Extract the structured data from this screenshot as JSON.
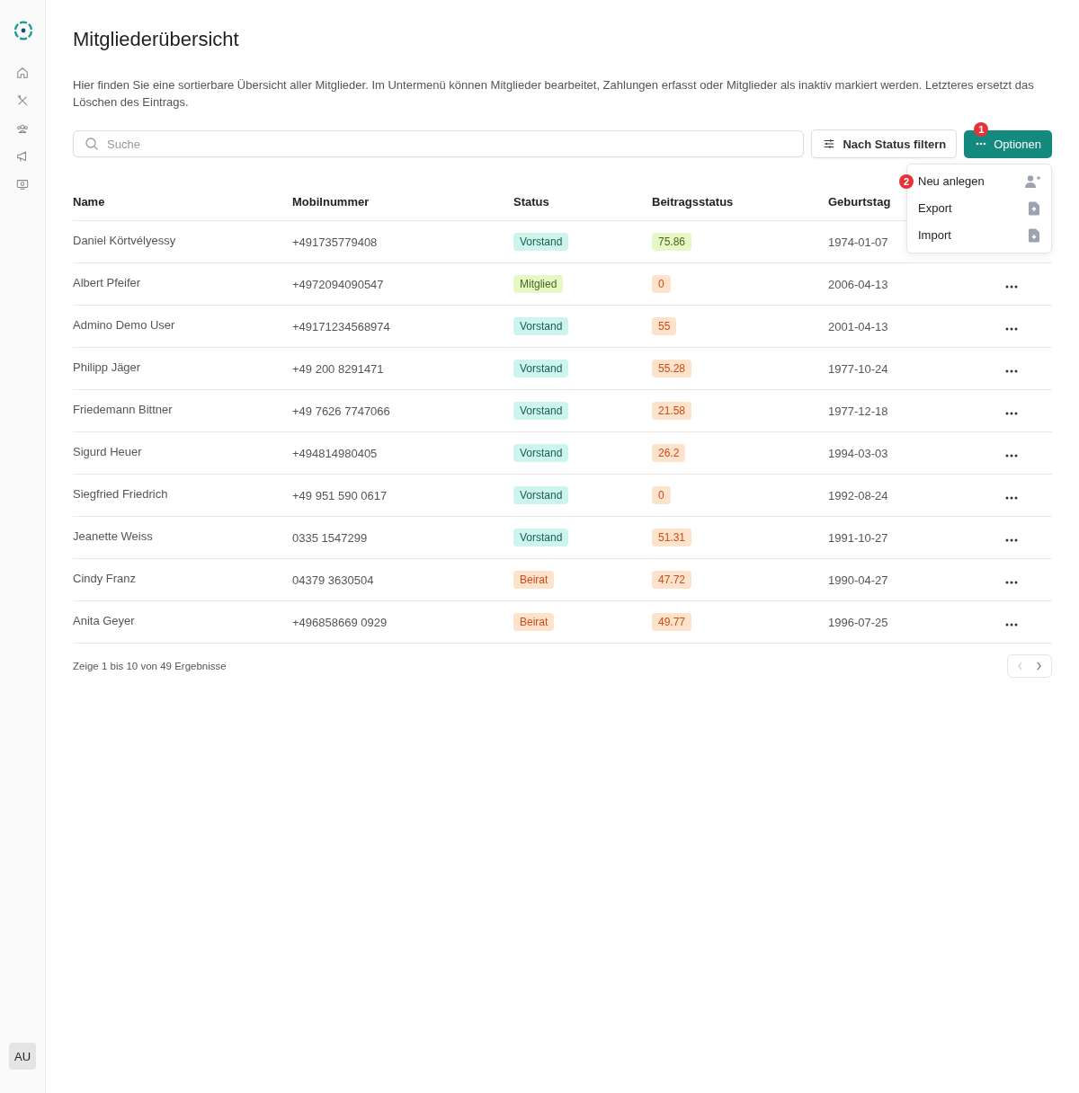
{
  "sidebar": {
    "items": [
      {
        "selected": false
      },
      {
        "selected": false
      },
      {
        "selected": false
      },
      {
        "selected": false
      },
      {
        "selected": false
      }
    ],
    "avatar": "AU"
  },
  "title": "Mitgliederübersicht",
  "description": "Hier finden Sie eine sortierbare Übersicht aller Mitglieder. Im Untermenü können Mitglieder bearbeitet, Zahlungen erfasst oder Mitglieder als inaktiv markiert werden. Letzteres ersetzt das Löschen des Eintrags.",
  "search": {
    "placeholder": "Suche"
  },
  "filter_button": "Nach Status filtern",
  "options_button": {
    "label": "Optionen",
    "marker": "1"
  },
  "menu": {
    "open": true,
    "items": [
      {
        "label": "Neu anlegen",
        "marker": "2"
      },
      {
        "label": "Export"
      },
      {
        "label": "Import"
      }
    ]
  },
  "table": {
    "columns": [
      "Name",
      "Mobilnummer",
      "Status",
      "Beitragsstatus",
      "Geburtstag"
    ],
    "rows": [
      {
        "name": "Daniel Körtvélyessy",
        "mobile": "+491735779408",
        "status": {
          "label": "Vorstand",
          "color": "#cdf5ee"
        },
        "fee": {
          "label": "75.86",
          "color": "#e5f8c6"
        },
        "birthday": "1974-01-07"
      },
      {
        "name": "Albert Pfeifer",
        "mobile": "+4972094090547",
        "status": {
          "label": "Mitglied",
          "color": "#e5f8c6"
        },
        "fee": {
          "label": "0",
          "color": "#fde2cc"
        },
        "birthday": "2006-04-13"
      },
      {
        "name": "Admino Demo User",
        "mobile": "+49171234568974",
        "status": {
          "label": "Vorstand",
          "color": "#cdf5ee"
        },
        "fee": {
          "label": "55",
          "color": "#fde2cc"
        },
        "birthday": "2001-04-13"
      },
      {
        "name": "Philipp Jäger",
        "mobile": "+49 200 8291471",
        "status": {
          "label": "Vorstand",
          "color": "#cdf5ee"
        },
        "fee": {
          "label": "55.28",
          "color": "#fde2cc"
        },
        "birthday": "1977-10-24"
      },
      {
        "name": "Friedemann Bittner",
        "mobile": "+49 7626 7747066",
        "status": {
          "label": "Vorstand",
          "color": "#cdf5ee"
        },
        "fee": {
          "label": "21.58",
          "color": "#fde2cc"
        },
        "birthday": "1977-12-18"
      },
      {
        "name": "Sigurd Heuer",
        "mobile": "+494814980405",
        "status": {
          "label": "Vorstand",
          "color": "#cdf5ee"
        },
        "fee": {
          "label": "26.2",
          "color": "#fde2cc"
        },
        "birthday": "1994-03-03"
      },
      {
        "name": "Siegfried Friedrich",
        "mobile": "+49 951 590 0617",
        "status": {
          "label": "Vorstand",
          "color": "#cdf5ee"
        },
        "fee": {
          "label": "0",
          "color": "#fde2cc"
        },
        "birthday": "1992-08-24"
      },
      {
        "name": "Jeanette Weiss",
        "mobile": "0335 1547299",
        "status": {
          "label": "Vorstand",
          "color": "#cdf5ee"
        },
        "fee": {
          "label": "51.31",
          "color": "#fde2cc"
        },
        "birthday": "1991-10-27"
      },
      {
        "name": "Cindy Franz",
        "mobile": "04379 3630504",
        "status": {
          "label": "Beirat",
          "color": "#fde2cc"
        },
        "fee": {
          "label": "47.72",
          "color": "#fde2cc"
        },
        "birthday": "1990-04-27"
      },
      {
        "name": "Anita Geyer",
        "mobile": "+496858669 0929",
        "status": {
          "label": "Beirat",
          "color": "#fde2cc"
        },
        "fee": {
          "label": "49.77",
          "color": "#fde2cc"
        },
        "birthday": "1996-07-25"
      }
    ]
  },
  "pagination": {
    "summary": "Zeige 1 bis 10 von 49 Ergebnisse",
    "prev_disabled": true,
    "next_disabled": false
  }
}
